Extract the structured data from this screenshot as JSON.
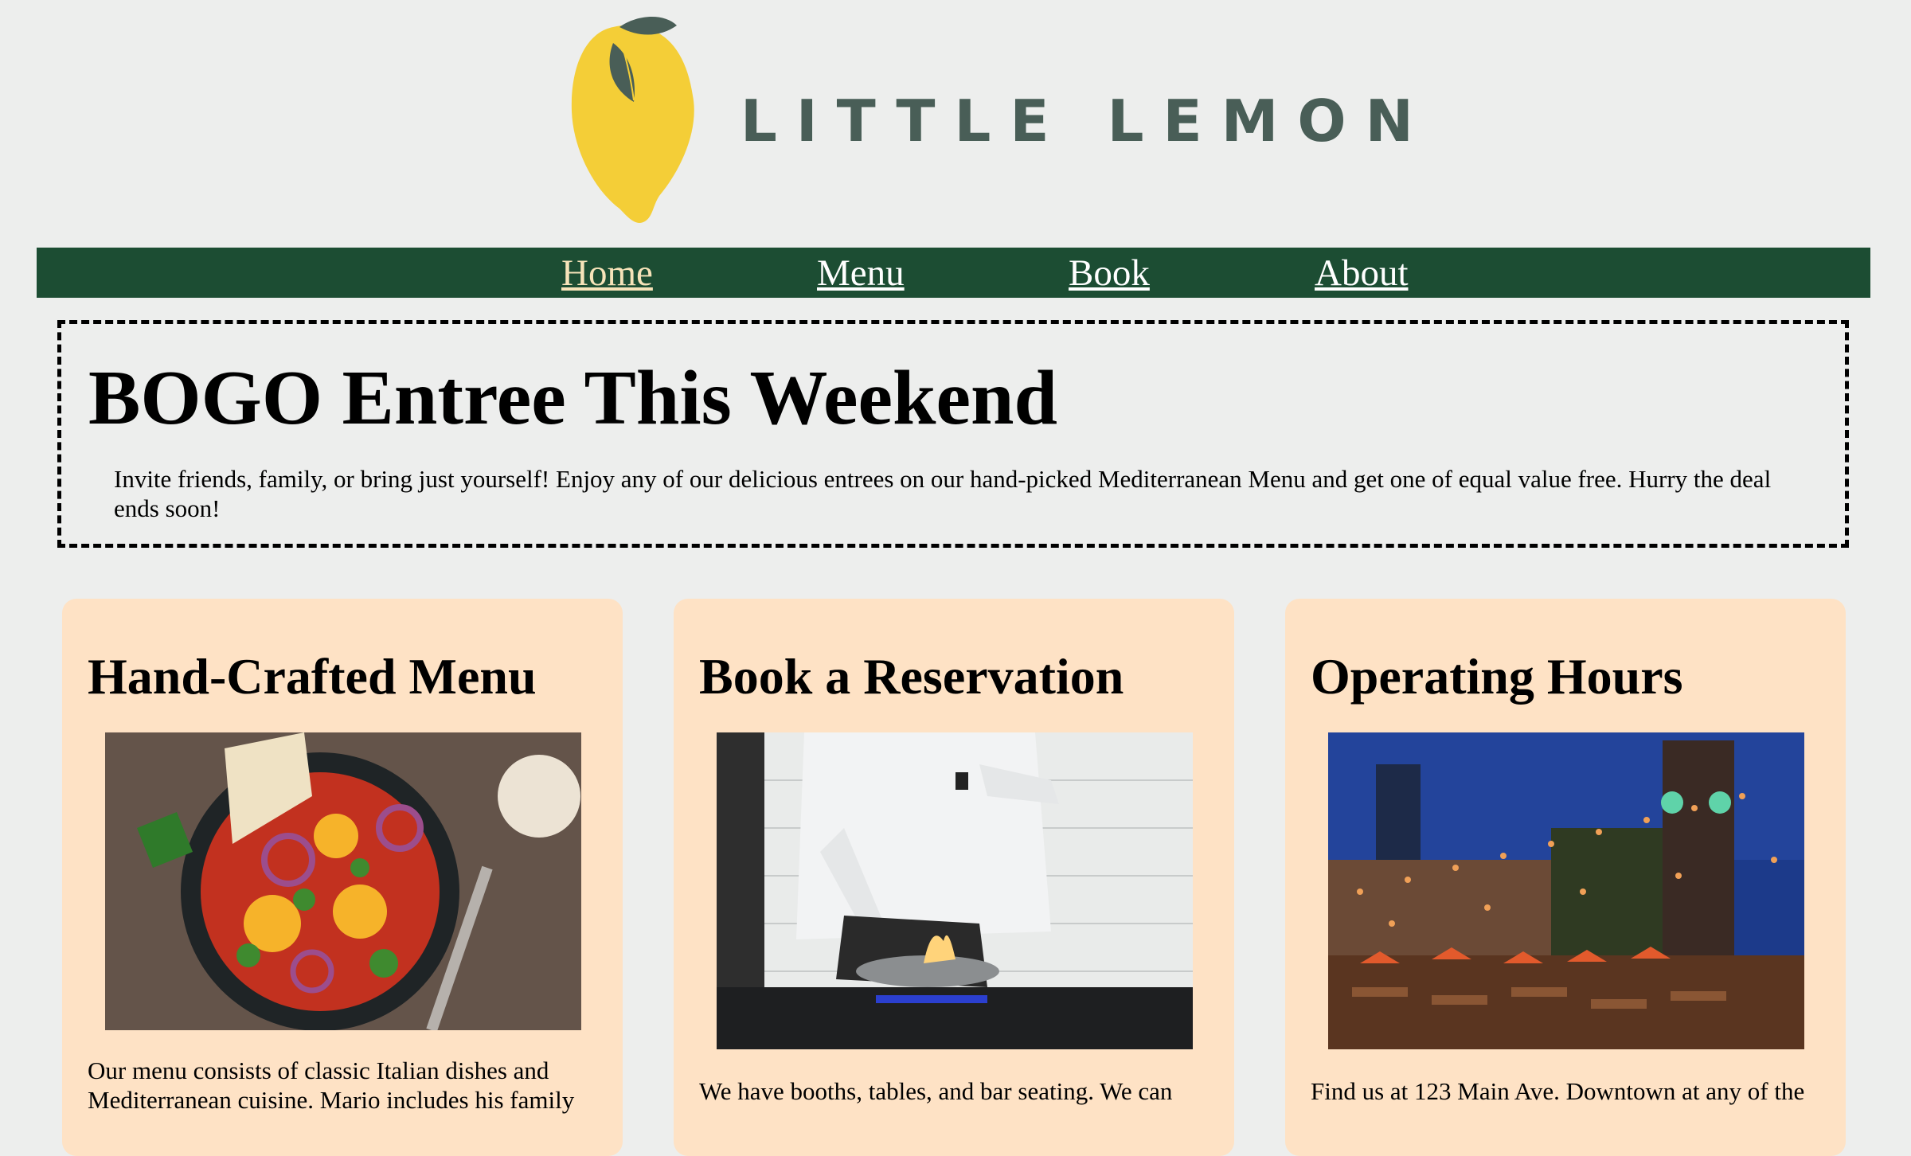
{
  "brand": {
    "name": "LITTLE LEMON",
    "colors": {
      "leaf": "#495e57",
      "lemon": "#f4ce37",
      "nav": "#1c4d33",
      "card": "#fee2c5",
      "active_link": "#f6e3b9"
    }
  },
  "nav": {
    "items": [
      {
        "label": "Home",
        "active": true
      },
      {
        "label": "Menu",
        "active": false
      },
      {
        "label": "Book",
        "active": false
      },
      {
        "label": "About",
        "active": false
      }
    ]
  },
  "promo": {
    "title": "BOGO Entree This Weekend",
    "body": "Invite friends, family, or bring just yourself! Enjoy any of our delicious entrees on our hand-picked Mediterranean Menu and get one of equal value free. Hurry the deal ends soon!"
  },
  "cards": [
    {
      "title": "Hand-Crafted Menu",
      "image": "shakshuka-dish-photo",
      "text": "Our menu consists of classic Italian dishes and Mediterranean cuisine. Mario includes his family"
    },
    {
      "title": "Book a Reservation",
      "image": "chef-flambe-photo",
      "text": "We have booths, tables, and bar seating. We can"
    },
    {
      "title": "Operating Hours",
      "image": "patio-night-photo",
      "text": "Find us at 123 Main Ave. Downtown at any of the"
    }
  ]
}
